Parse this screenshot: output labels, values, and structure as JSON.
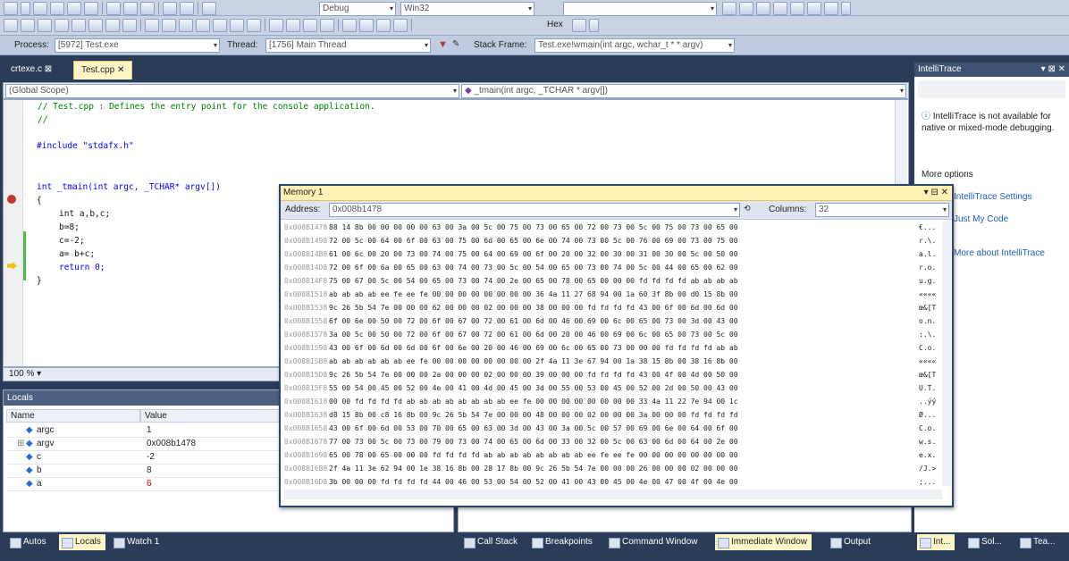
{
  "toolbar": {
    "config_combo": "Debug",
    "platform_combo": "Win32",
    "hex_label": "Hex",
    "process_label": "Process:",
    "process_value": "[5972] Test.exe",
    "thread_label": "Thread:",
    "thread_value": "[1756] Main Thread",
    "stack_frame_label": "Stack Frame:",
    "stack_frame_value": "Test.exe!wmain(int argc, wchar_t * * argv)"
  },
  "tabs": [
    {
      "label": "crtexe.c"
    },
    {
      "label": "Test.cpp"
    }
  ],
  "scope": {
    "left": "(Global Scope)",
    "right": "_tmain(int argc, _TCHAR * argv[])"
  },
  "code": {
    "line1": "// Test.cpp : Defines the entry point for the console application.",
    "line2": "//",
    "line3": "#include \"stdafx.h\"",
    "line4": "int _tmain(int argc, _TCHAR* argv[])",
    "line5": "{",
    "line6": "int a,b,c;",
    "line7": "b=8;",
    "line8": "c=-2;",
    "line9": "a= b+c;",
    "line10": "return 0;",
    "line11": "}"
  },
  "zoom": "100 %",
  "locals": {
    "title": "Locals",
    "col_name": "Name",
    "col_value": "Value",
    "rows": [
      {
        "name": "argc",
        "value": "1"
      },
      {
        "name": "argv",
        "value": "0x008b1478"
      },
      {
        "name": "c",
        "value": "-2"
      },
      {
        "name": "b",
        "value": "8"
      },
      {
        "name": "a",
        "value": "6"
      }
    ]
  },
  "memory": {
    "title": "Memory 1",
    "address_label": "Address:",
    "address_value": "0x008b1478",
    "columns_label": "Columns:",
    "columns_value": "32",
    "rows": [
      {
        "addr": "0x008B1478",
        "hex": "88 14 8b 00 00 00 00 00 63 00 3a 00 5c 00 75 00 73 00 65 00 72 00 73 00 5c 00 75 00 73 00 65 00",
        "text": "€..."
      },
      {
        "addr": "0x008B1498",
        "hex": "72 00 5c 00 64 00 6f 00 63 00 75 00 6d 00 65 00 6e 00 74 00 73 00 5c 00 76 00 69 00 73 00 75 00",
        "text": "r.\\."
      },
      {
        "addr": "0x008B14B8",
        "hex": "61 00 6c 00 20 00 73 00 74 00 75 00 64 00 69 00 6f 00 20 00 32 00 30 00 31 00 30 00 5c 00 50 00",
        "text": "a.l."
      },
      {
        "addr": "0x008B14D8",
        "hex": "72 00 6f 00 6a 00 65 00 63 00 74 00 73 00 5c 00 54 00 65 00 73 00 74 00 5c 00 44 00 65 00 62 00",
        "text": "r.o."
      },
      {
        "addr": "0x008B14F8",
        "hex": "75 00 67 00 5c 00 54 00 65 00 73 00 74 00 2e 00 65 00 78 00 65 00 00 00 fd fd fd fd ab ab ab ab",
        "text": "u.g."
      },
      {
        "addr": "0x008B1518",
        "hex": "ab ab ab ab ee fe ee fe 00 00 00 00 00 00 00 00 36 4a 11 27 68 94 00 1a 60 3f 8b 00 d0 15 8b 00",
        "text": "««««"
      },
      {
        "addr": "0x008B1538",
        "hex": "9c 26 5b 54 7e 00 00 00 62 00 00 00 02 00 00 00 38 00 00 00 fd fd fd fd 43 00 6f 00 6d 00 6d 00",
        "text": "œ&[T"
      },
      {
        "addr": "0x008B1558",
        "hex": "6f 00 6e 00 50 00 72 00 6f 00 67 00 72 00 61 00 6d 00 46 00 69 00 6c 00 65 00 73 00 3d 00 43 00",
        "text": "o.n."
      },
      {
        "addr": "0x008B1578",
        "hex": "3a 00 5c 00 50 00 72 00 6f 00 67 00 72 00 61 00 6d 00 20 00 46 00 69 00 6c 00 65 00 73 00 5c 00",
        "text": ":.\\."
      },
      {
        "addr": "0x008B1598",
        "hex": "43 00 6f 00 6d 00 6d 00 6f 00 6e 00 20 00 46 00 69 00 6c 00 65 00 73 00 00 00 fd fd fd fd ab ab",
        "text": "C.o."
      },
      {
        "addr": "0x008B15B8",
        "hex": "ab ab ab ab ab ab ee fe 00 00 00 00 00 00 00 00 2f 4a 11 3e 67 94 00 1a 38 15 8b 00 38 16 8b 00",
        "text": "««««"
      },
      {
        "addr": "0x008B15D8",
        "hex": "9c 26 5b 54 7e 00 00 00 2a 00 00 00 02 00 00 00 39 00 00 00 fd fd fd fd 43 00 4f 00 4d 00 50 00",
        "text": "œ&[T"
      },
      {
        "addr": "0x008B15F8",
        "hex": "55 00 54 00 45 00 52 00 4e 00 41 00 4d 00 45 00 3d 00 55 00 53 00 45 00 52 00 2d 00 50 00 43 00",
        "text": "U.T."
      },
      {
        "addr": "0x008B1618",
        "hex": "00 00 fd fd fd fd ab ab ab ab ab ab ab ab ee fe 00 00 00 00 00 00 00 00 33 4a 11 22 7e 94 00 1c",
        "text": "..ýý"
      },
      {
        "addr": "0x008B1638",
        "hex": "d8 15 8b 00 c8 16 8b 00 9c 26 5b 54 7e 00 00 00 48 00 00 00 02 00 00 00 3a 00 00 00 fd fd fd fd",
        "text": "Ø..."
      },
      {
        "addr": "0x008B1658",
        "hex": "43 00 6f 00 6d 00 53 00 70 00 65 00 63 00 3d 00 43 00 3a 00 5c 00 57 00 69 00 6e 00 64 00 6f 00",
        "text": "C.o."
      },
      {
        "addr": "0x008B1678",
        "hex": "77 00 73 00 5c 00 73 00 79 00 73 00 74 00 65 00 6d 00 33 00 32 00 5c 00 63 00 6d 00 64 00 2e 00",
        "text": "w.s."
      },
      {
        "addr": "0x008B1698",
        "hex": "65 00 78 00 65 00 00 00 fd fd fd fd ab ab ab ab ab ab ab ab ee fe ee fe 00 00 00 00 00 00 00 00",
        "text": "e.x."
      },
      {
        "addr": "0x008B16B8",
        "hex": "2f 4a 11 3e 62 94 00 1e 38 16 8b 00 28 17 8b 00 9c 26 5b 54 7e 00 00 00 26 00 00 00 02 00 00 00",
        "text": "/J.>"
      },
      {
        "addr": "0x008B16D8",
        "hex": "3b 00 00 00 fd fd fd fd 44 00 46 00 53 00 54 00 52 00 41 00 43 00 45 00 4e 00 47 00 4f 00 4e 00",
        "text": ";..."
      }
    ]
  },
  "intellitrace": {
    "title": "IntelliTrace",
    "message": "IntelliTrace is not available for native or mixed-mode debugging.",
    "more_options": "More options",
    "link1": "IntelliTrace Settings",
    "link2": "Just My Code",
    "link3": "More about IntelliTrace"
  },
  "bottom_tabs_left": [
    "Autos",
    "Locals",
    "Watch 1"
  ],
  "bottom_tabs_mid": [
    "Call Stack",
    "Breakpoints",
    "Command Window",
    "Immediate Window",
    "Output"
  ],
  "bottom_tabs_right": [
    "Int...",
    "Sol...",
    "Tea..."
  ]
}
